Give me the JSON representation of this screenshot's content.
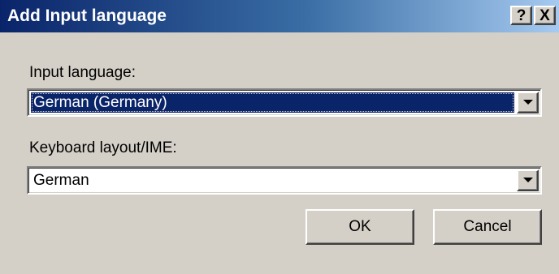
{
  "window": {
    "title": "Add Input language",
    "help_glyph": "?",
    "close_glyph": "X"
  },
  "input_language": {
    "label": "Input language:",
    "value": "German (Germany)"
  },
  "keyboard_layout": {
    "label": "Keyboard layout/IME:",
    "value": "German"
  },
  "buttons": {
    "ok_label": "OK",
    "cancel_label": "Cancel"
  },
  "colors": {
    "title_bar_start": "#0a246a",
    "title_bar_end": "#a6caf0",
    "selection": "#0a246a",
    "face": "#d4d0c8"
  },
  "icons": {
    "help": "help-icon",
    "close": "close-icon",
    "dropdown": "chevron-down-icon"
  }
}
